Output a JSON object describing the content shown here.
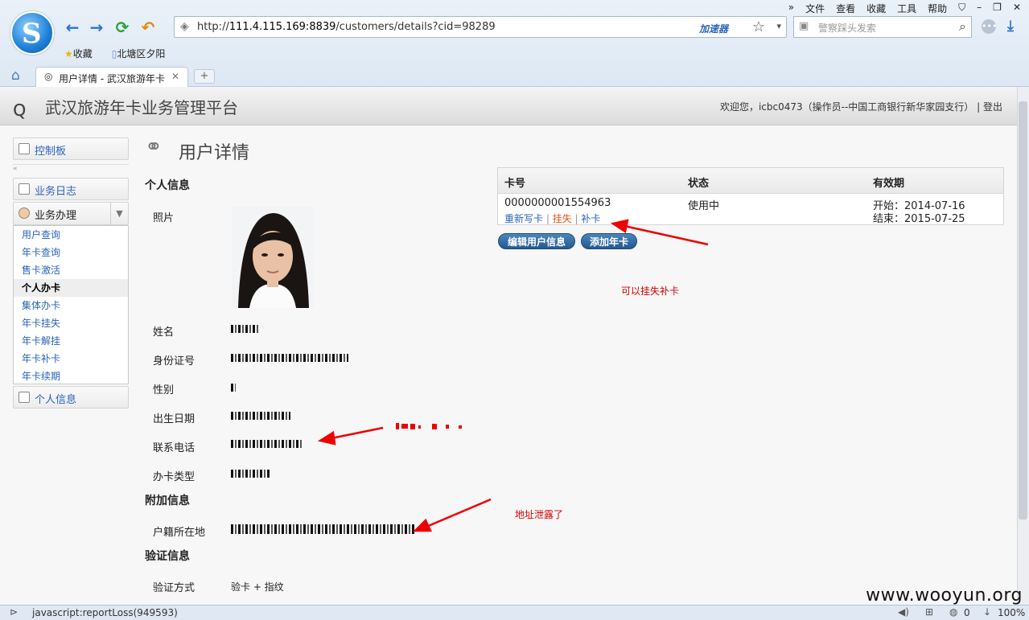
{
  "browser": {
    "menu": [
      "»",
      "文件",
      "查看",
      "收藏",
      "工具",
      "帮助"
    ],
    "url_prefix": "http://",
    "url_host": "111.4.115.169:8839",
    "url_path": "/customers/details?cid=98289",
    "accelerator": "加速器",
    "search_placeholder": "警察踩头发索",
    "bookmarks": [
      "收藏",
      "北塘区夕阳"
    ],
    "tab_title": "用户详情 - 武汉旅游年卡",
    "status_text": "javascript:reportLoss(949593)",
    "status_zoom": "100%",
    "status_count": "0"
  },
  "app": {
    "title": "武汉旅游年卡业务管理平台",
    "welcome": "欢迎您，icbc0473（操作员--中国工商银行新华家园支行）",
    "logout": "登出"
  },
  "sidebar": {
    "dashboard": "控制板",
    "log": "业务日志",
    "business": "业务办理",
    "items": [
      "用户查询",
      "年卡查询",
      "售卡激活",
      "个人办卡",
      "集体办卡",
      "年卡挂失",
      "年卡解挂",
      "年卡补卡",
      "年卡续期"
    ],
    "personal": "个人信息"
  },
  "page": {
    "title": "用户详情",
    "section_personal": "个人信息",
    "section_extra": "附加信息",
    "section_verify": "验证信息",
    "labels": {
      "photo": "照片",
      "name": "姓名",
      "id": "身份证号",
      "gender": "性别",
      "birth": "出生日期",
      "phone": "联系电话",
      "card_type": "办卡类型",
      "address": "户籍所在地",
      "verify_method": "验证方式"
    },
    "verify_value": "验卡 + 指纹"
  },
  "cards": {
    "headers": [
      "卡号",
      "状态",
      "有效期"
    ],
    "rows": [
      {
        "number": "0000000001554963",
        "status": "使用中",
        "start": "开始：2014-07-16",
        "end": "结束：2015-07-25",
        "actions": [
          "重新写卡",
          "挂失",
          "补卡"
        ]
      }
    ],
    "edit_button": "编辑用户信息",
    "add_button": "添加年卡"
  },
  "annotations": {
    "reissue": "可以挂失补卡",
    "address_leak": "地址泄露了"
  },
  "watermark": "www.wooyun.org"
}
